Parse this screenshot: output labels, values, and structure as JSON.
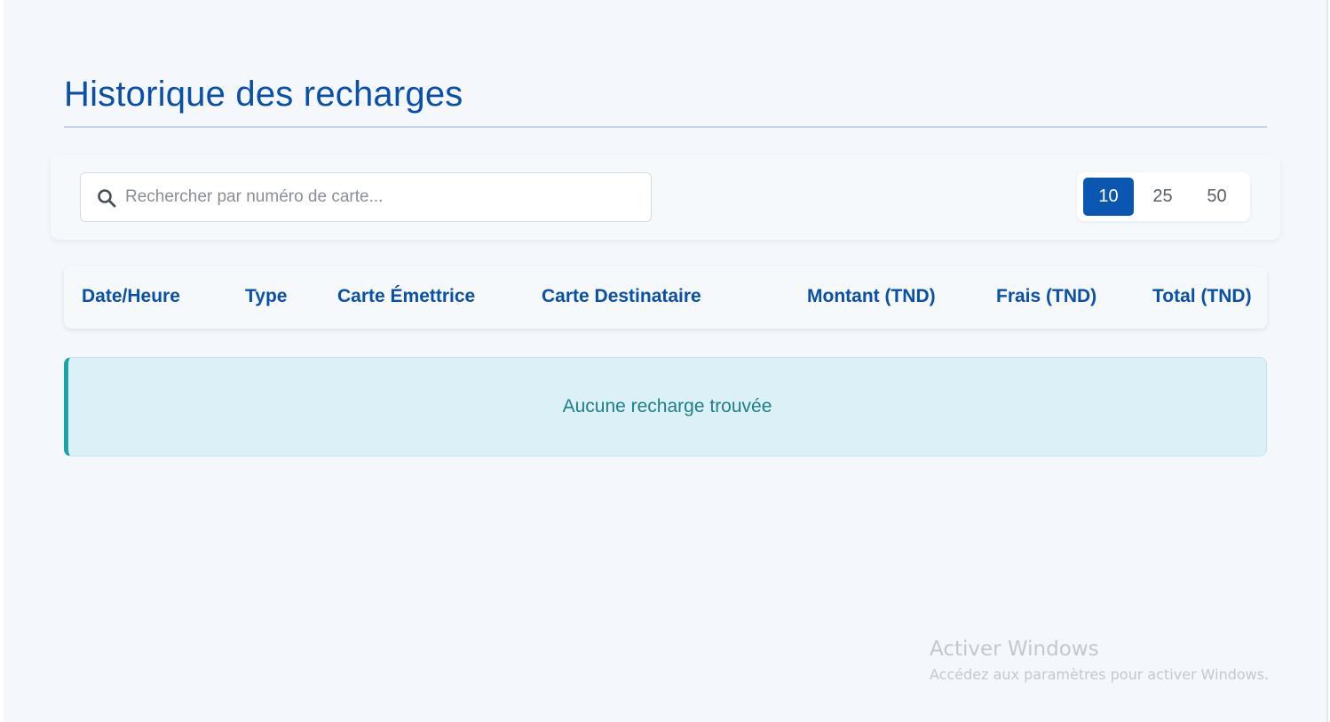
{
  "page": {
    "title": "Historique des recharges"
  },
  "search": {
    "placeholder": "Rechercher par numéro de carte..."
  },
  "page_size": {
    "options": [
      "10",
      "25",
      "50"
    ],
    "selected": "10"
  },
  "table": {
    "columns": [
      "Date/Heure",
      "Type",
      "Carte Émettrice",
      "Carte Destinataire",
      "Montant (TND)",
      "Frais (TND)",
      "Total (TND)"
    ],
    "empty_message": "Aucune recharge trouvée"
  },
  "watermark": {
    "title": "Activer Windows",
    "subtitle": "Accédez aux paramètres pour activer Windows."
  },
  "colors": {
    "primary": "#0a56b0",
    "heading": "#0a4fa8",
    "info_bg": "#dcf0f7",
    "info_accent": "#1aa3a8",
    "info_text": "#1f7f86"
  },
  "icons": {
    "search": "search-icon"
  }
}
